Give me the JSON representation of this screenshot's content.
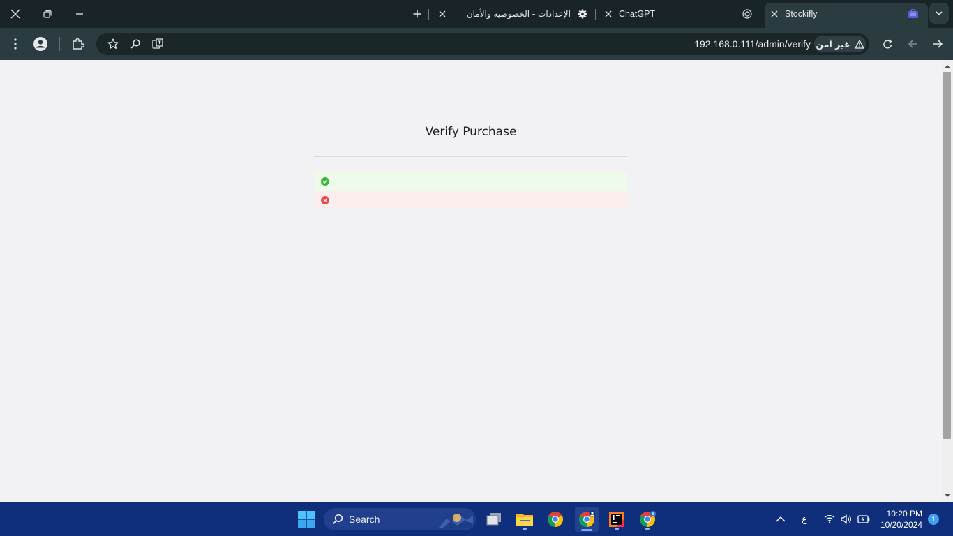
{
  "browser": {
    "tabs": [
      {
        "title": "Stockifly",
        "active": true
      },
      {
        "title": "ChatGPT",
        "active": false
      },
      {
        "title": "الإعدادات - الخصوصية والأمان",
        "active": false
      }
    ],
    "address": {
      "url": "192.168.0.111/admin/verify",
      "security_label": "غير آمن"
    }
  },
  "page": {
    "heading": "Verify Purchase",
    "status_rows": [
      {
        "status": "success",
        "color": "#3cb83c"
      },
      {
        "status": "error",
        "color": "#ef4a4a"
      }
    ]
  },
  "taskbar": {
    "search_placeholder": "Search",
    "language_indicator": "ع",
    "time": "10:20 PM",
    "date": "10/20/2024",
    "notification_count": "1",
    "apps": [
      "start-icon",
      "search-icon",
      "task-view-icon",
      "file-explorer-icon",
      "chrome-icon",
      "chrome-profile-icon",
      "intellij-icon",
      "chrome-badge-icon"
    ]
  },
  "colors": {
    "titlebar": "#192428",
    "toolbar": "#2b3c41",
    "page_background": "#f2f2f5",
    "taskbar": "#0f2f7c"
  }
}
